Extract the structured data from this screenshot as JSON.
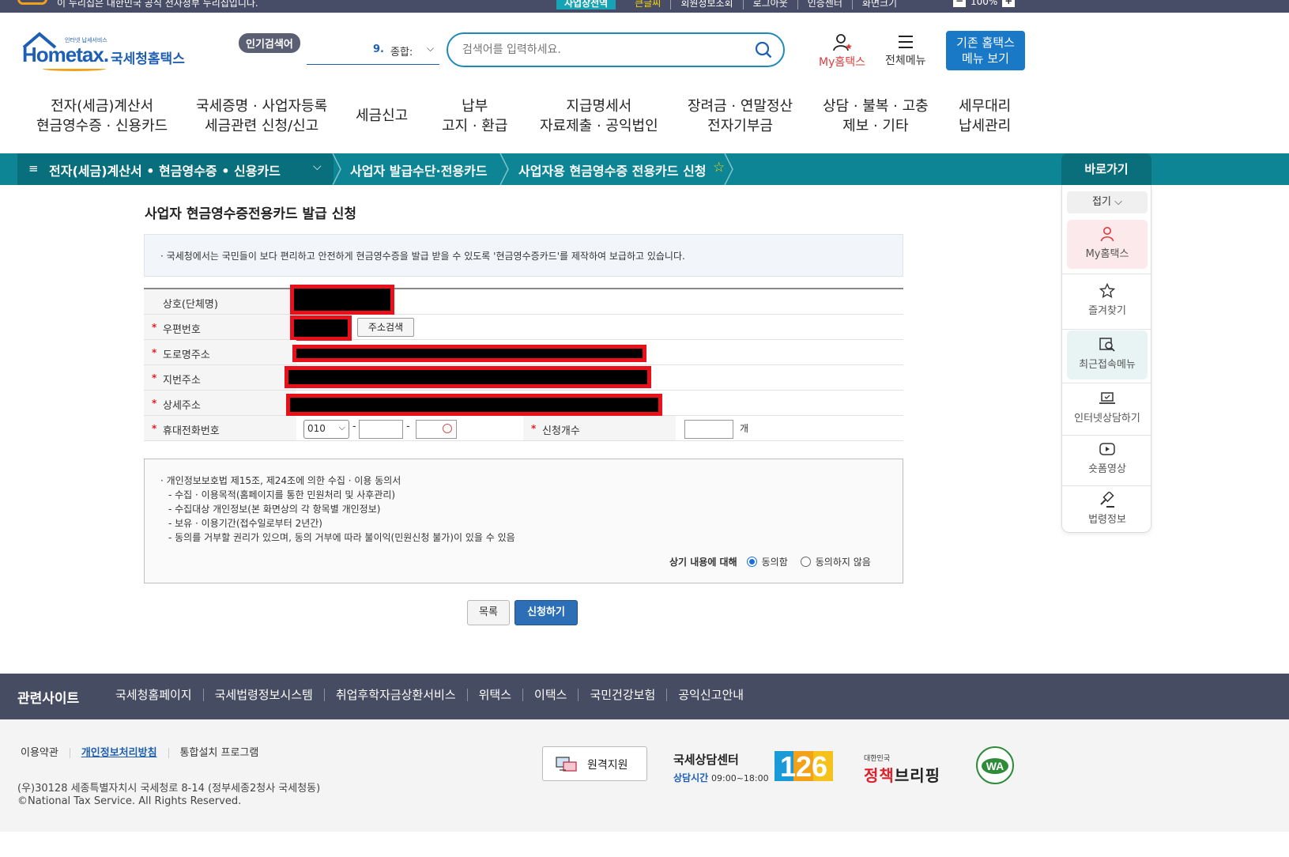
{
  "topbar": {
    "notice": "이 누리집은 대한민국 공식 전자정부 누리집입니다.",
    "links": [
      "사업장전역",
      "큰글씨",
      "회원정보조회",
      "로그아웃",
      "인증센터",
      "화면크기"
    ],
    "zoom": "100%"
  },
  "header": {
    "logo_small": "인터넷 납세서비스",
    "logo_brand": "Hometax.",
    "logo_kr": "국세청홈택스",
    "popular_label": "인기검색어",
    "rank_num": "9.",
    "rank_term": "종합:",
    "search_placeholder": "검색어를 입력하세요.",
    "my_hometax": "My홈택스",
    "all_menu": "전체메뉴",
    "old_menu_line1": "기존 홈택스",
    "old_menu_line2": "메뉴 보기"
  },
  "mainnav": [
    {
      "l1": "전자(세금)계산서",
      "l2": "현금영수증 · 신용카드"
    },
    {
      "l1": "국세증명 · 사업자등록",
      "l2": "세금관련 신청/신고"
    },
    {
      "l1": "세금신고",
      "l2": ""
    },
    {
      "l1": "납부",
      "l2": "고지 · 환급"
    },
    {
      "l1": "지급명세서",
      "l2": "자료제출 · 공익법인"
    },
    {
      "l1": "장려금 · 연말정산",
      "l2": "전자기부금"
    },
    {
      "l1": "상담 · 불복 · 고충",
      "l2": "제보 · 기타"
    },
    {
      "l1": "세무대리",
      "l2": "납세관리"
    }
  ],
  "breadcrumb": {
    "c1": "전자(세금)계산서 • 현금영수증 • 신용카드",
    "c2": "사업자 발급수단·전용카드",
    "c3": "사업자용 현금영수증 전용카드 신청"
  },
  "quick": {
    "title": "바로가기",
    "fold": "접기",
    "items": [
      "My홈택스",
      "즐겨찾기",
      "최근접속메뉴",
      "인터넷상담하기",
      "숏폼영상",
      "법령정보"
    ]
  },
  "page": {
    "title": "사업자 현금영수증전용카드 발급 신청",
    "info": "국세청에서는 국민들이 보다 편리하고 안전하게 현금영수증을 발급 받을 수 있도록 '현금영수증카드'를 제작하여 보급하고 있습니다."
  },
  "form": {
    "labels": [
      "상호(단체명)",
      "우편번호",
      "도로명주소",
      "지번주소",
      "상세주소",
      "휴대전화번호"
    ],
    "required_mark": "*",
    "address_search": "주소검색",
    "phone_prefix": "010",
    "count_label": "신청개수",
    "count_unit": "개",
    "dash": "-"
  },
  "consent": {
    "lines": [
      "개인정보보호법 제15조, 제24조에 의한 수집 · 이용 동의서",
      "- 수집 · 이용목적(홈페이지를 통한 민원처리 및 사후관리)",
      "- 수집대상 개인정보(본 화면상의 각 항목별 개인정보)",
      "- 보유 · 이용기간(접수일로부터 2년간)",
      "- 동의를 거부할 권리가 있으며, 동의  거부에 따라 불이익(민원신청 불가)이 있을 수 있음"
    ],
    "prompt": "상기 내용에 대해",
    "agree": "동의함",
    "disagree": "동의하지 않음",
    "selected": "agree"
  },
  "buttons": {
    "list": "목록",
    "apply": "신청하기"
  },
  "related": {
    "title": "관련사이트",
    "links": [
      "국세청홈페이지",
      "국세법령정보시스템",
      "취업후학자금상환서비스",
      "위택스",
      "이택스",
      "국민건강보험",
      "공익신고안내"
    ]
  },
  "footer": {
    "links": [
      "이용약관",
      "개인정보처리방침",
      "통합설치 프로그램"
    ],
    "address": "(우)30128 세종특별자치시 국세청로 8-14 (정부세종2청사 국세청동)",
    "copyright": "©National Tax Service. All Rights Reserved.",
    "remote": "원격지원",
    "cc_title": "국세상담센터",
    "cc_hours_label": "상담시간",
    "cc_hours": "09:00~18:00",
    "cc_number": "126",
    "brief_small": "대한민국",
    "brief_large_a": "정책",
    "brief_large_b": "브리핑",
    "wa": "WA"
  },
  "colors": {
    "teal": "#0d8594",
    "teal_dark": "#0a6f7c",
    "brand_blue": "#1e5fb4",
    "footer_band": "#464d63",
    "redact_border": "#e8101a"
  }
}
